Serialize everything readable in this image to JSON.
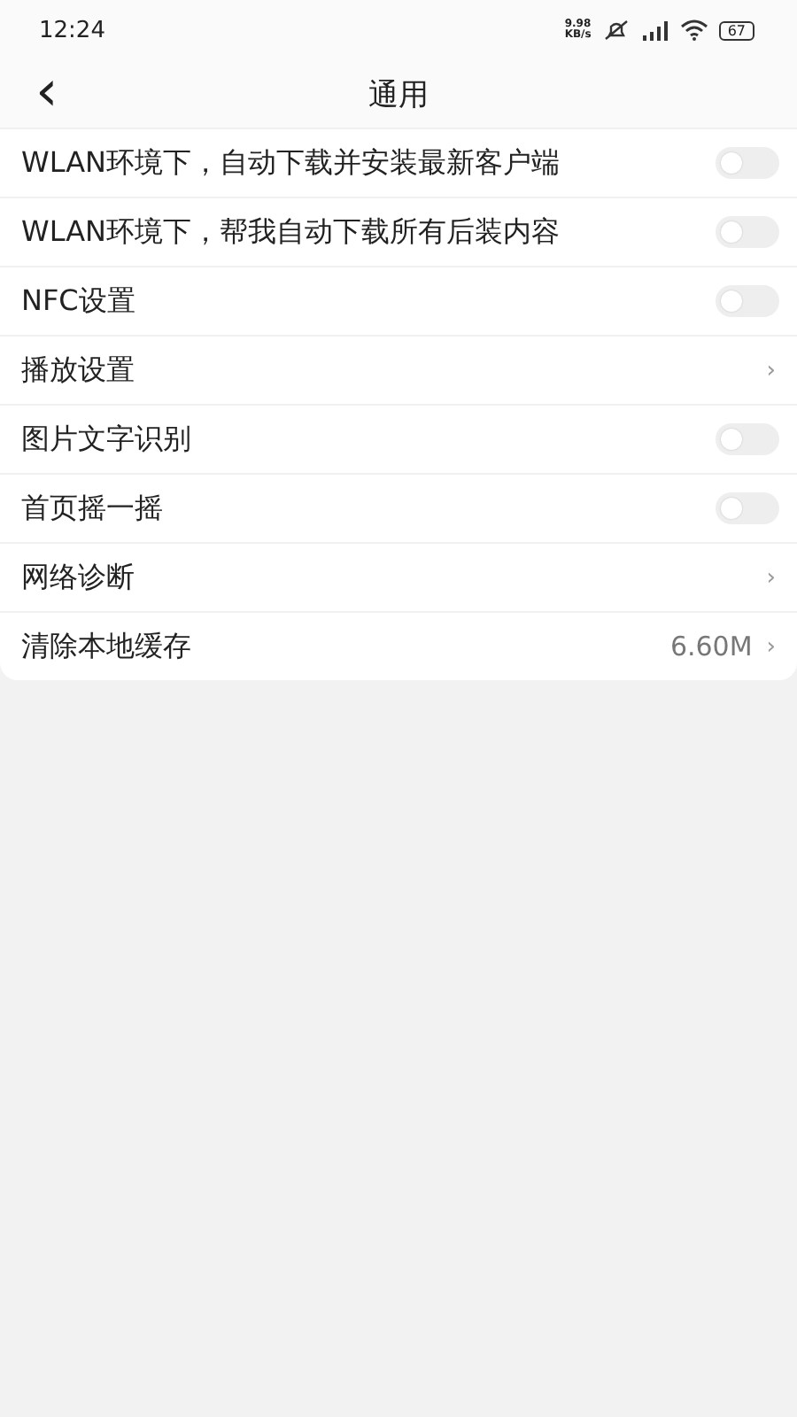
{
  "status_bar": {
    "time": "12:24",
    "speed_value": "9.98",
    "speed_unit": "KB/s",
    "battery": "67"
  },
  "header": {
    "back": "‹",
    "title": "通用"
  },
  "items": [
    {
      "kind": "toggle",
      "label": "WLAN环境下，自动下载并安装最新客户端",
      "on": false
    },
    {
      "kind": "toggle",
      "label": "WLAN环境下，帮我自动下载所有后装内容",
      "on": false
    },
    {
      "kind": "toggle",
      "label": "NFC设置",
      "on": false
    },
    {
      "kind": "link",
      "label": "播放设置",
      "chevron": "›"
    },
    {
      "kind": "toggle",
      "label": "图片文字识别",
      "on": false
    },
    {
      "kind": "toggle",
      "label": "首页摇一摇",
      "on": false
    },
    {
      "kind": "link",
      "label": "网络诊断",
      "chevron": "›"
    },
    {
      "kind": "link",
      "label": "清除本地缓存",
      "value": "6.60M",
      "chevron": "›"
    }
  ]
}
